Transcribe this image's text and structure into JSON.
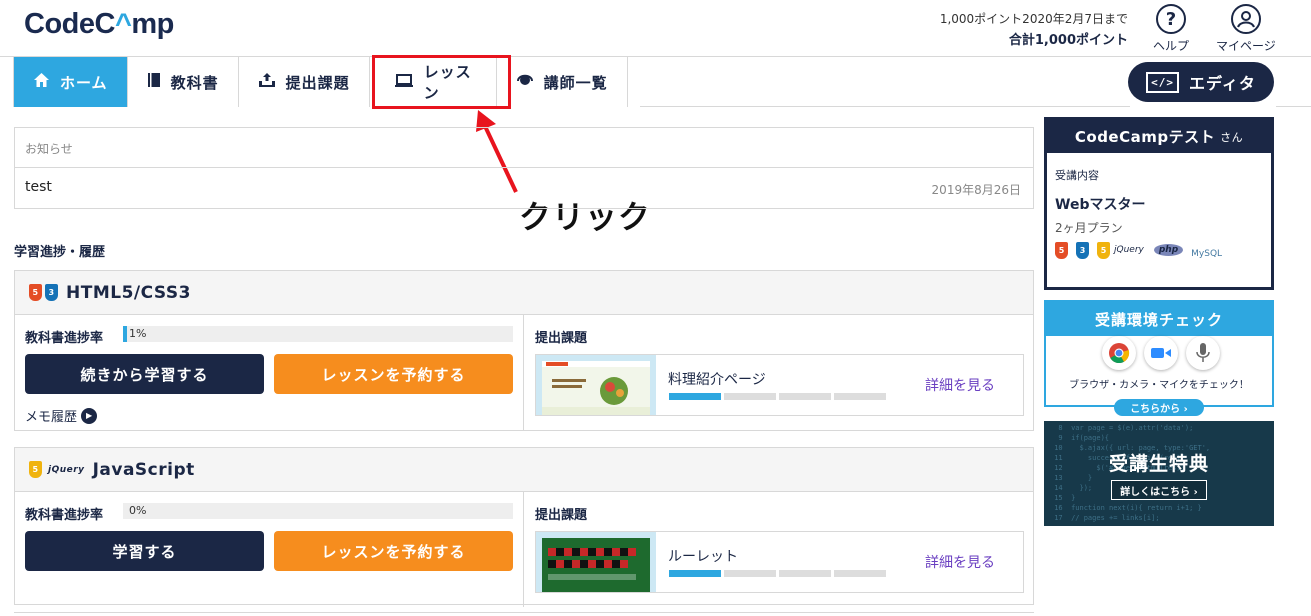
{
  "header": {
    "logo_pre": "CodeC",
    "logo_caret": "^",
    "logo_post": "mp",
    "points_expiry": "1,000ポイント2020年2月7日まで",
    "points_total": "合計1,000ポイント",
    "help_label": "ヘルプ",
    "mypage_label": "マイページ"
  },
  "nav": {
    "items": [
      {
        "label": "ホーム",
        "icon": "home-icon"
      },
      {
        "label": "教科書",
        "icon": "book-icon"
      },
      {
        "label": "提出課題",
        "icon": "upload-icon"
      },
      {
        "label": "レッスン",
        "icon": "laptop-icon"
      },
      {
        "label": "講師一覧",
        "icon": "headset-icon"
      }
    ],
    "editor_label": "エディタ",
    "editor_icon_text": "</>"
  },
  "annotation": {
    "label": "クリック",
    "color": "#e8141e"
  },
  "notice": {
    "heading": "お知らせ",
    "items": [
      {
        "title": "test",
        "date": "2019年8月26日"
      }
    ]
  },
  "progress_section": {
    "title": "学習進捗・履歴",
    "courses": [
      {
        "name": "HTML5/CSS3",
        "progress_label": "教科書進捗率",
        "progress_text": "1%",
        "progress": 1,
        "primary_button": "続きから学習する",
        "reserve_button": "レッスンを予約する",
        "memo_label": "メモ履歴",
        "task_label": "提出課題",
        "task_title": "料理紹介ページ",
        "task_steps_done": 1,
        "task_steps_total": 4,
        "detail_label": "詳細を見る"
      },
      {
        "name": "JavaScript",
        "progress_label": "教科書進捗率",
        "progress_text": "0%",
        "progress": 0,
        "primary_button": "学習する",
        "reserve_button": "レッスンを予約する",
        "task_label": "提出課題",
        "task_title": "ルーレット",
        "task_steps_done": 1,
        "task_steps_total": 4,
        "detail_label": "詳細を見る"
      }
    ]
  },
  "sidebar": {
    "user_name": "CodeCampテスト",
    "user_suffix": "さん",
    "enrollment_label": "受講内容",
    "course_name": "Webマスター",
    "plan": "2ヶ月プラン",
    "tech_icons": [
      "html5-icon",
      "css3-icon",
      "js-icon",
      "jquery-icon",
      "php-icon",
      "mysql-icon"
    ],
    "jquery_text": "jQuery",
    "php_text": "php",
    "mysql_text": "MySQL",
    "env_check_title": "受講環境チェック",
    "env_check_text": "ブラウザ・カメラ・マイクをチェック！",
    "env_check_button": "こちらから ›",
    "perk_title": "受講生特典",
    "perk_button": "詳しくはこちら ›"
  },
  "colors": {
    "navy": "#1b2745",
    "accent_blue": "#2ea7e0",
    "orange": "#f68d1e",
    "link_purple": "#6a3fc1"
  }
}
